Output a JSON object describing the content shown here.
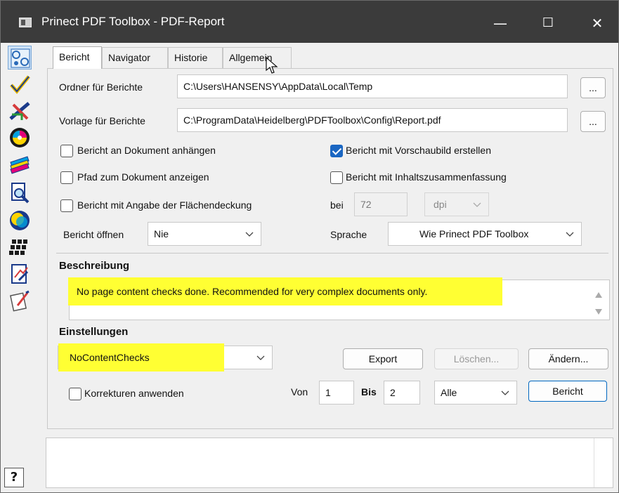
{
  "window": {
    "title": "Prinect PDF Toolbox - PDF-Report",
    "controls": {
      "minimize": "—",
      "maximize": "☐",
      "close": "✕"
    }
  },
  "sidebar": {
    "tools": [
      {
        "icon": "report-tool-icon",
        "active": true
      },
      {
        "icon": "check-tool-icon"
      },
      {
        "icon": "navigator-tool-icon"
      },
      {
        "icon": "color-disc-icon"
      },
      {
        "icon": "color-swatches-icon"
      },
      {
        "icon": "inspect-magnifier-icon"
      },
      {
        "icon": "overprint-circles-icon"
      },
      {
        "icon": "grid-tiles-icon"
      },
      {
        "icon": "page-edit-icon"
      },
      {
        "icon": "pen-edit-icon"
      }
    ],
    "help_label": "?"
  },
  "tabs": [
    {
      "label": "Bericht",
      "active": true
    },
    {
      "label": "Navigator"
    },
    {
      "label": "Historie"
    },
    {
      "label": "Allgemein"
    }
  ],
  "bericht": {
    "folder_label": "Ordner für Berichte",
    "folder_value": "C:\\Users\\HANSENSY\\AppData\\Local\\Temp",
    "template_label": "Vorlage für Berichte",
    "template_value": "C:\\ProgramData\\Heidelberg\\PDFToolbox\\Config\\Report.pdf",
    "browse_label": "...",
    "options": {
      "attach": {
        "label": "Bericht an Dokument anhängen",
        "checked": false
      },
      "show_path": {
        "label": "Pfad zum Dokument anzeigen",
        "checked": false
      },
      "coverage": {
        "label": "Bericht mit Angabe der Flächendeckung",
        "checked": false
      },
      "preview": {
        "label": "Bericht mit Vorschaubild erstellen",
        "checked": true
      },
      "summary": {
        "label": "Bericht mit Inhaltszusammenfassung",
        "checked": false
      }
    },
    "bei_label": "bei",
    "dpi_value": "72",
    "dpi_unit": "dpi",
    "open_label": "Bericht öffnen",
    "open_value": "Nie",
    "language_label": "Sprache",
    "language_value": "Wie Prinect PDF Toolbox",
    "description_heading": "Beschreibung",
    "description_text": "No page content checks done. Recommended for very complex documents only.",
    "settings_heading": "Einstellungen",
    "settings_value": "NoContentChecks",
    "export_label": "Export",
    "delete_label": "Löschen...",
    "change_label": "Ändern...",
    "corrections_label": "Korrekturen anwenden",
    "corrections_checked": false,
    "from_label": "Von",
    "from_value": "1",
    "to_label": "Bis",
    "to_value": "2",
    "pages_value": "Alle",
    "report_button_label": "Bericht"
  },
  "colors": {
    "titlebar": "#3b3b3b",
    "highlight": "#ffff33",
    "checkbox_checked": "#1a66c2"
  }
}
